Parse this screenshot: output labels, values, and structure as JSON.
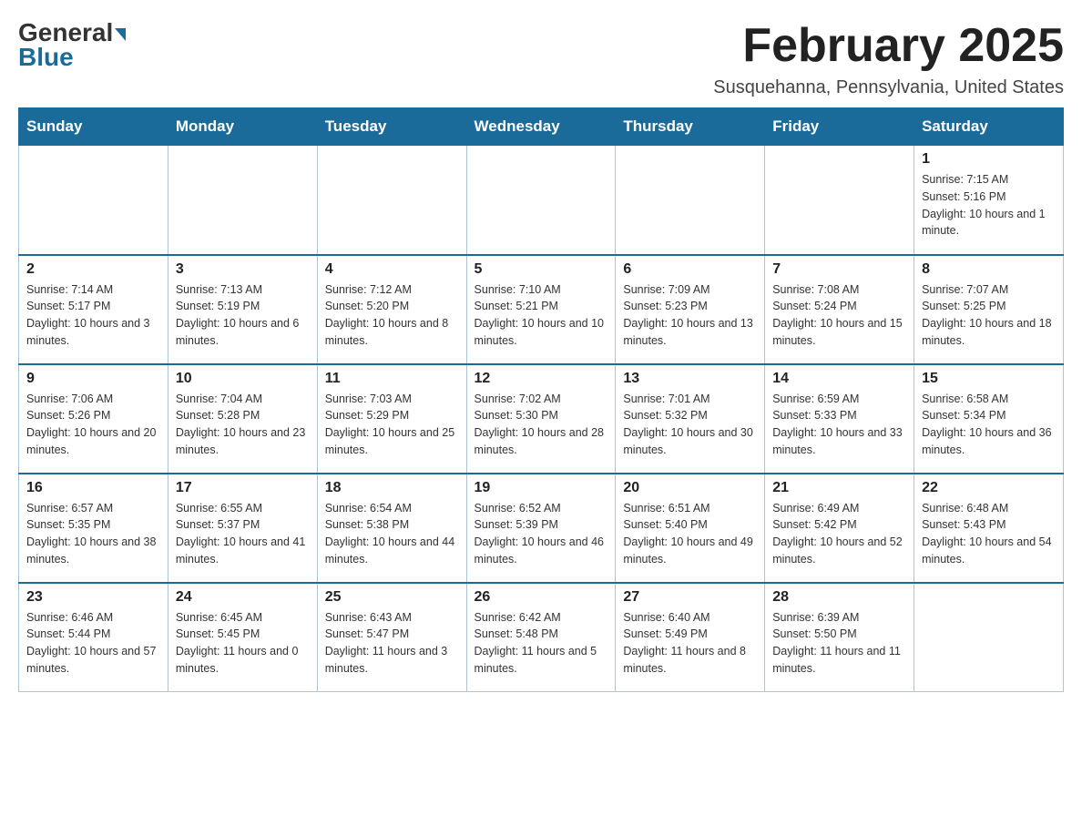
{
  "header": {
    "logo_general": "General",
    "logo_blue": "Blue",
    "month_year": "February 2025",
    "location": "Susquehanna, Pennsylvania, United States"
  },
  "weekdays": [
    "Sunday",
    "Monday",
    "Tuesday",
    "Wednesday",
    "Thursday",
    "Friday",
    "Saturday"
  ],
  "weeks": [
    {
      "days": [
        {
          "num": "",
          "info": ""
        },
        {
          "num": "",
          "info": ""
        },
        {
          "num": "",
          "info": ""
        },
        {
          "num": "",
          "info": ""
        },
        {
          "num": "",
          "info": ""
        },
        {
          "num": "",
          "info": ""
        },
        {
          "num": "1",
          "info": "Sunrise: 7:15 AM\nSunset: 5:16 PM\nDaylight: 10 hours and 1 minute."
        }
      ]
    },
    {
      "days": [
        {
          "num": "2",
          "info": "Sunrise: 7:14 AM\nSunset: 5:17 PM\nDaylight: 10 hours and 3 minutes."
        },
        {
          "num": "3",
          "info": "Sunrise: 7:13 AM\nSunset: 5:19 PM\nDaylight: 10 hours and 6 minutes."
        },
        {
          "num": "4",
          "info": "Sunrise: 7:12 AM\nSunset: 5:20 PM\nDaylight: 10 hours and 8 minutes."
        },
        {
          "num": "5",
          "info": "Sunrise: 7:10 AM\nSunset: 5:21 PM\nDaylight: 10 hours and 10 minutes."
        },
        {
          "num": "6",
          "info": "Sunrise: 7:09 AM\nSunset: 5:23 PM\nDaylight: 10 hours and 13 minutes."
        },
        {
          "num": "7",
          "info": "Sunrise: 7:08 AM\nSunset: 5:24 PM\nDaylight: 10 hours and 15 minutes."
        },
        {
          "num": "8",
          "info": "Sunrise: 7:07 AM\nSunset: 5:25 PM\nDaylight: 10 hours and 18 minutes."
        }
      ]
    },
    {
      "days": [
        {
          "num": "9",
          "info": "Sunrise: 7:06 AM\nSunset: 5:26 PM\nDaylight: 10 hours and 20 minutes."
        },
        {
          "num": "10",
          "info": "Sunrise: 7:04 AM\nSunset: 5:28 PM\nDaylight: 10 hours and 23 minutes."
        },
        {
          "num": "11",
          "info": "Sunrise: 7:03 AM\nSunset: 5:29 PM\nDaylight: 10 hours and 25 minutes."
        },
        {
          "num": "12",
          "info": "Sunrise: 7:02 AM\nSunset: 5:30 PM\nDaylight: 10 hours and 28 minutes."
        },
        {
          "num": "13",
          "info": "Sunrise: 7:01 AM\nSunset: 5:32 PM\nDaylight: 10 hours and 30 minutes."
        },
        {
          "num": "14",
          "info": "Sunrise: 6:59 AM\nSunset: 5:33 PM\nDaylight: 10 hours and 33 minutes."
        },
        {
          "num": "15",
          "info": "Sunrise: 6:58 AM\nSunset: 5:34 PM\nDaylight: 10 hours and 36 minutes."
        }
      ]
    },
    {
      "days": [
        {
          "num": "16",
          "info": "Sunrise: 6:57 AM\nSunset: 5:35 PM\nDaylight: 10 hours and 38 minutes."
        },
        {
          "num": "17",
          "info": "Sunrise: 6:55 AM\nSunset: 5:37 PM\nDaylight: 10 hours and 41 minutes."
        },
        {
          "num": "18",
          "info": "Sunrise: 6:54 AM\nSunset: 5:38 PM\nDaylight: 10 hours and 44 minutes."
        },
        {
          "num": "19",
          "info": "Sunrise: 6:52 AM\nSunset: 5:39 PM\nDaylight: 10 hours and 46 minutes."
        },
        {
          "num": "20",
          "info": "Sunrise: 6:51 AM\nSunset: 5:40 PM\nDaylight: 10 hours and 49 minutes."
        },
        {
          "num": "21",
          "info": "Sunrise: 6:49 AM\nSunset: 5:42 PM\nDaylight: 10 hours and 52 minutes."
        },
        {
          "num": "22",
          "info": "Sunrise: 6:48 AM\nSunset: 5:43 PM\nDaylight: 10 hours and 54 minutes."
        }
      ]
    },
    {
      "days": [
        {
          "num": "23",
          "info": "Sunrise: 6:46 AM\nSunset: 5:44 PM\nDaylight: 10 hours and 57 minutes."
        },
        {
          "num": "24",
          "info": "Sunrise: 6:45 AM\nSunset: 5:45 PM\nDaylight: 11 hours and 0 minutes."
        },
        {
          "num": "25",
          "info": "Sunrise: 6:43 AM\nSunset: 5:47 PM\nDaylight: 11 hours and 3 minutes."
        },
        {
          "num": "26",
          "info": "Sunrise: 6:42 AM\nSunset: 5:48 PM\nDaylight: 11 hours and 5 minutes."
        },
        {
          "num": "27",
          "info": "Sunrise: 6:40 AM\nSunset: 5:49 PM\nDaylight: 11 hours and 8 minutes."
        },
        {
          "num": "28",
          "info": "Sunrise: 6:39 AM\nSunset: 5:50 PM\nDaylight: 11 hours and 11 minutes."
        },
        {
          "num": "",
          "info": ""
        }
      ]
    }
  ]
}
